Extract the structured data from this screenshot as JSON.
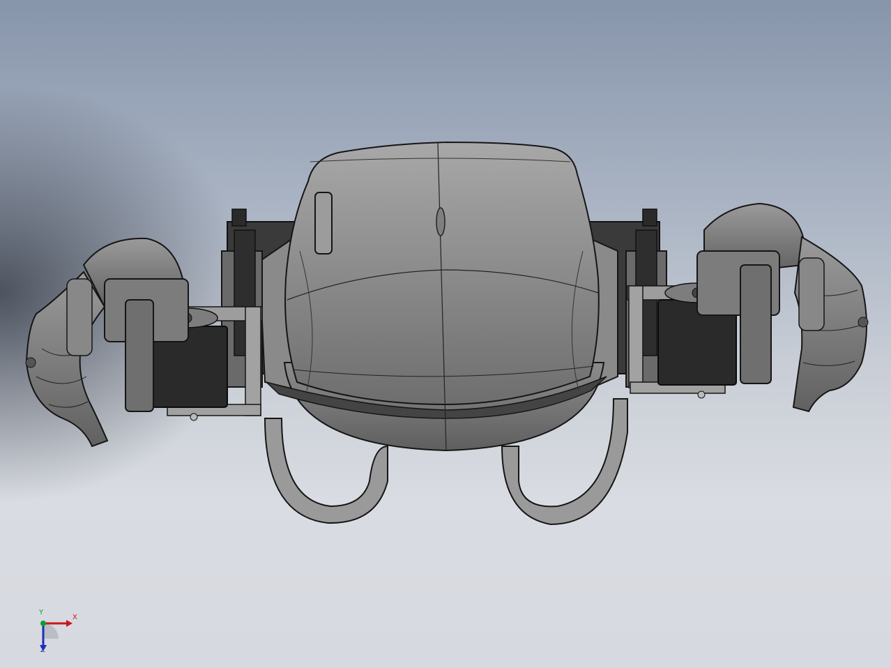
{
  "viewport": {
    "name": "cad-graphics-area",
    "model": "robot-torso-with-arms"
  },
  "triad": {
    "x_label": "X",
    "y_label": "Y",
    "z_label": "Z",
    "x_color": "#c81818",
    "y_color": "#119c2d",
    "z_color": "#1f2fb8"
  },
  "colors": {
    "background_top": "#8795ab",
    "background_bottom": "#d6d9df",
    "shell": "#8c8c8c",
    "servo": "#2d2d2d",
    "edge": "#151515"
  }
}
